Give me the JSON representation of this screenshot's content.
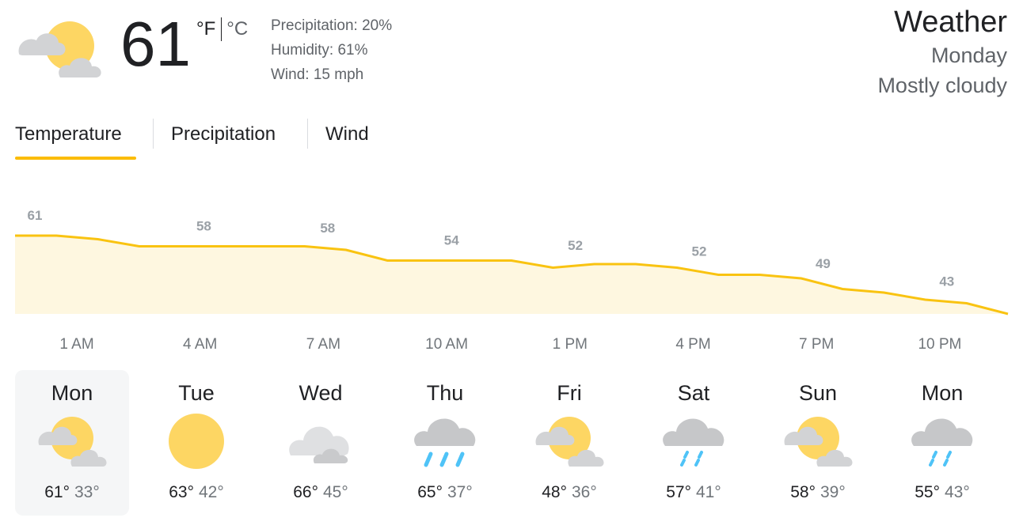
{
  "current": {
    "icon": "partly-cloudy-icon",
    "temperature": "61",
    "unit_f": "°F",
    "unit_c": "°C",
    "precipitation": "Precipitation: 20%",
    "humidity": "Humidity: 61%",
    "wind": "Wind: 15 mph"
  },
  "title": {
    "heading": "Weather",
    "day": "Monday",
    "condition": "Mostly cloudy"
  },
  "tabs": [
    {
      "label": "Temperature",
      "active": true
    },
    {
      "label": "Precipitation",
      "active": false
    },
    {
      "label": "Wind",
      "active": false
    }
  ],
  "colors": {
    "accent": "#fbbc04",
    "chart_line": "#f9c311",
    "chart_fill": "#fef7e0",
    "sun": "#fdd663",
    "cloud": "#d2d3d5",
    "rain": "#4fc3f7"
  },
  "chart_data": {
    "type": "area",
    "labeled_times": [
      "1 AM",
      "4 AM",
      "7 AM",
      "10 AM",
      "1 PM",
      "4 PM",
      "7 PM",
      "10 PM"
    ],
    "labeled_values": [
      61,
      58,
      58,
      54,
      52,
      52,
      49,
      43
    ],
    "series": [
      {
        "values": [
          61,
          61,
          60,
          58,
          58,
          58,
          58,
          58,
          57,
          54,
          54,
          54,
          54,
          52,
          53,
          53,
          52,
          50,
          50,
          49,
          46,
          45,
          43,
          42,
          39
        ]
      }
    ]
  },
  "forecast": [
    {
      "day": "Mon",
      "icon": "partly-cloudy-icon",
      "high": "61°",
      "low": "33°",
      "selected": true
    },
    {
      "day": "Tue",
      "icon": "sunny-icon",
      "high": "63°",
      "low": "42°",
      "selected": false
    },
    {
      "day": "Wed",
      "icon": "cloudy-icon",
      "high": "66°",
      "low": "45°",
      "selected": false
    },
    {
      "day": "Thu",
      "icon": "rain-icon",
      "high": "65°",
      "low": "37°",
      "selected": false
    },
    {
      "day": "Fri",
      "icon": "partly-cloudy-icon",
      "high": "48°",
      "low": "36°",
      "selected": false
    },
    {
      "day": "Sat",
      "icon": "showers-icon",
      "high": "57°",
      "low": "41°",
      "selected": false
    },
    {
      "day": "Sun",
      "icon": "partly-cloudy-icon",
      "high": "58°",
      "low": "39°",
      "selected": false
    },
    {
      "day": "Mon",
      "icon": "showers-icon",
      "high": "55°",
      "low": "43°",
      "selected": false
    }
  ]
}
